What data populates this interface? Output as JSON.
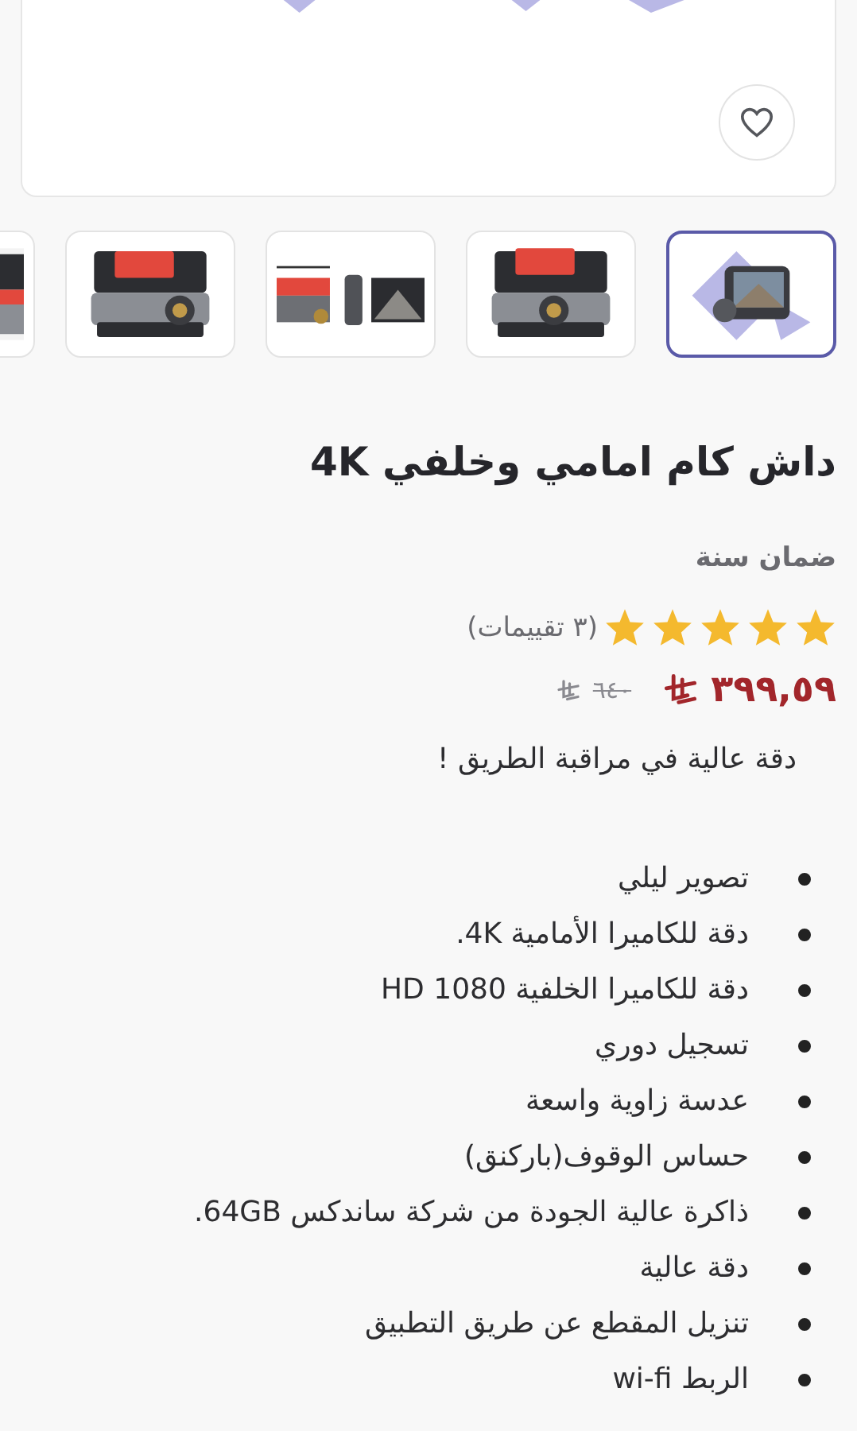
{
  "gallery": {
    "favorited": false,
    "thumbnails": [
      {
        "selected": true
      },
      {
        "selected": false
      },
      {
        "selected": false
      },
      {
        "selected": false
      },
      {
        "selected": false
      }
    ]
  },
  "title": "داش كام امامي وخلفي 4K",
  "warranty": "ضمان سنة",
  "rating": {
    "stars": 5,
    "count": "(٣ تقييمات)"
  },
  "price": {
    "current": "٣٩٩,٥٩",
    "original": "٦٤٠"
  },
  "tagline": "دقة عالية في مراقبة الطريق !",
  "features": [
    "تصوير ليلي",
    "دقة للكاميرا الأمامية 4K.",
    "دقة للكاميرا الخلفية HD 1080",
    "تسجيل دوري",
    "عدسة زاوية واسعة",
    "حساس الوقوف(باركنق)",
    "ذاكرة عالية الجودة من شركة ساندكس 64GB.",
    "دقة عالية",
    "تنزيل المقطع عن طريق التطبيق",
    "الربط wi-fi"
  ]
}
